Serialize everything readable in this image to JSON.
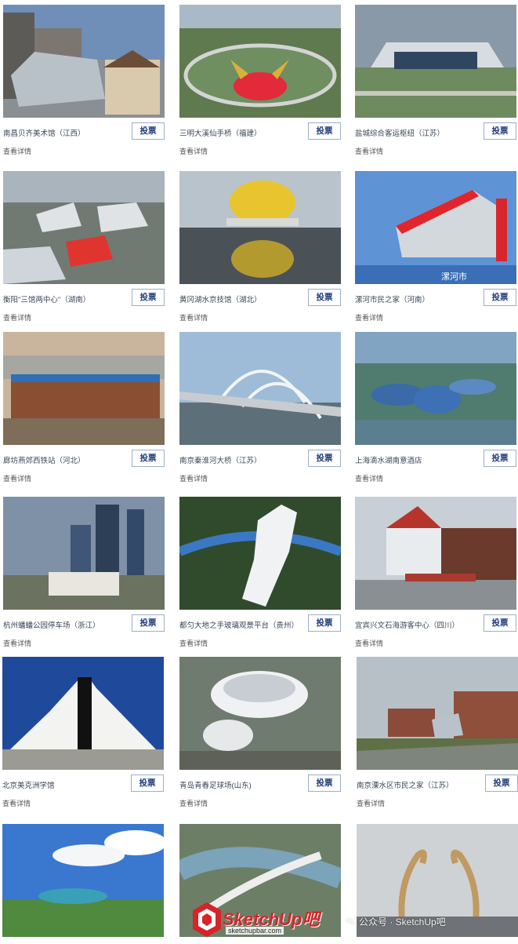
{
  "vote_label": "投票",
  "detail_label": "查看详情",
  "cards": [
    {
      "name": "南昌贝齐美术馆（江西）"
    },
    {
      "name": "三明大溪仙手桥（福建）"
    },
    {
      "name": "盐城综合客运枢纽（江苏）"
    },
    {
      "name": "衡阳\"三馆两中心\"（湖南）"
    },
    {
      "name": "黄冈湖水京技馆（湖北）"
    },
    {
      "name": "漯河市民之家（河南）"
    },
    {
      "name": "廊坊燕郊西铁站（河北）"
    },
    {
      "name": "南京秦淮河大桥（江苏）"
    },
    {
      "name": "上海滴水湖南意酒店"
    },
    {
      "name": "杭州蟠蟠公园停车场（浙江）"
    },
    {
      "name": "都匀大地之手玻璃观景平台（贵州）"
    },
    {
      "name": "宜宾兴文石海游客中心（四川）"
    },
    {
      "name": "北京美克洲学馆"
    },
    {
      "name": "青岛青春足球场(山东)"
    },
    {
      "name": "南京溧水区市民之家（江苏）"
    },
    {
      "name": ""
    },
    {
      "name": ""
    },
    {
      "name": ""
    }
  ],
  "photo_text": {
    "card6": "漯河市"
  },
  "watermark": {
    "brand": "SketchUp吧",
    "url": "sketchupbar.com"
  },
  "wechat": {
    "label": "公众号 · SketchUp吧"
  }
}
